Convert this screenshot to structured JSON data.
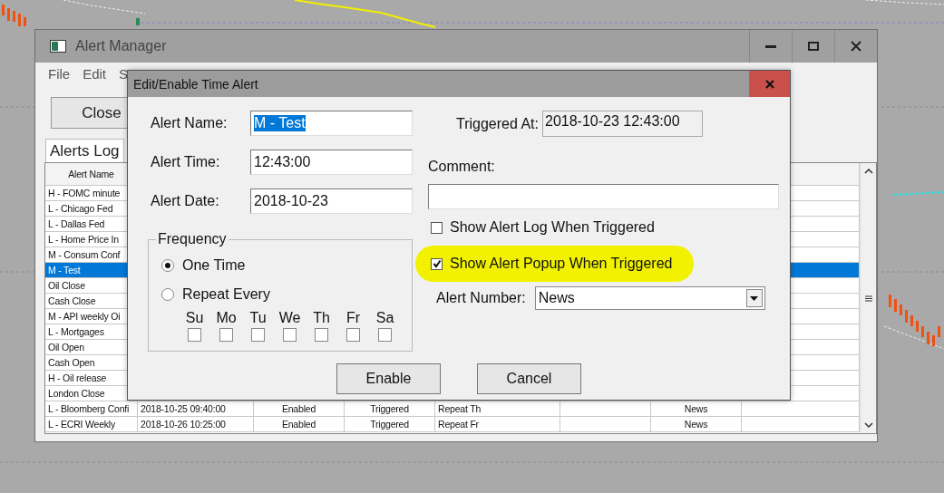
{
  "main_window": {
    "title": "Alert Manager",
    "menu": [
      "File",
      "Edit",
      "S"
    ],
    "close_button": "Close",
    "tabs": [
      {
        "label": "Alerts Log",
        "selected": true
      }
    ],
    "table": {
      "columns": [
        "Alert Name"
      ],
      "rows": [
        {
          "name": "H - FOMC minute",
          "selected": false
        },
        {
          "name": "L - Chicago Fed",
          "selected": false
        },
        {
          "name": "L - Dallas Fed",
          "selected": false
        },
        {
          "name": "L - Home Price In",
          "selected": false
        },
        {
          "name": "M - Consum Conf",
          "selected": false
        },
        {
          "name": "M - Test",
          "selected": true
        },
        {
          "name": "Oil Close",
          "selected": false
        },
        {
          "name": "Cash Close",
          "selected": false
        },
        {
          "name": "M - API weekly Oi",
          "selected": false
        },
        {
          "name": "L - Mortgages",
          "selected": false
        },
        {
          "name": "Oil Open",
          "selected": false
        },
        {
          "name": "Cash Open",
          "selected": false
        },
        {
          "name": "H - Oil release",
          "selected": false
        },
        {
          "name": "London Close",
          "selected": false
        },
        {
          "name": "L - Bloomberg Confi",
          "column_2": "2018-10-25  09:40:00",
          "column_3": "Enabled",
          "column_4": "Triggered",
          "column_5": "Repeat Th",
          "column_7": "News",
          "selected": false
        },
        {
          "name": "L - ECRI Weekly",
          "column_2": "2018-10-26  10:25:00",
          "column_3": "Enabled",
          "column_4": "Triggered",
          "column_5": "Repeat Fr",
          "column_7": "News",
          "selected": false
        }
      ]
    }
  },
  "dialog": {
    "title": "Edit/Enable Time Alert",
    "fields": [
      {
        "label": "Alert Name:",
        "value": "M - Test",
        "selected": true
      },
      {
        "label": "Alert Time:",
        "value": "12:43:00",
        "selected": false
      },
      {
        "label": "Alert Date:",
        "value": "2018-10-23",
        "selected": false
      }
    ],
    "frequency": {
      "label": "Frequency",
      "options": [
        {
          "label": "One Time",
          "selected": true
        },
        {
          "label": "Repeat Every",
          "selected": false
        }
      ],
      "days": [
        {
          "label": "Su",
          "checked": false
        },
        {
          "label": "Mo",
          "checked": false
        },
        {
          "label": "Tu",
          "checked": false
        },
        {
          "label": "We",
          "checked": false
        },
        {
          "label": "Th",
          "checked": false
        },
        {
          "label": "Fr",
          "checked": false
        },
        {
          "label": "Sa",
          "checked": false
        }
      ]
    },
    "triggered_at": {
      "label": "Triggered At:",
      "value": "2018-10-23  12:43:00"
    },
    "comment": {
      "label": "Comment:"
    },
    "checkboxes": [
      {
        "label": "Show Alert Log When Triggered",
        "checked": false,
        "highlighted": false
      },
      {
        "label": "Show Alert Popup When Triggered",
        "checked": true,
        "highlighted": true
      }
    ],
    "alert_number": {
      "label": "Alert Number:",
      "value": "News"
    },
    "buttons": [
      "Enable",
      "Cancel"
    ]
  }
}
